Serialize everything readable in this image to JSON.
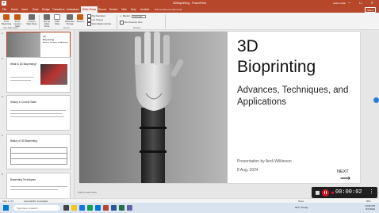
{
  "window": {
    "app_icon": "P",
    "title": "3DBioprinting - PowerPoint",
    "user": "Andrei Nalic",
    "controls": "─ ☐ ✕"
  },
  "tabs": [
    "File",
    "Home",
    "Insert",
    "Draw",
    "Design",
    "Transitions",
    "Animations",
    "Slide Show",
    "Record",
    "Review",
    "View",
    "Help",
    "Acrobat",
    "Tell me what you want to do"
  ],
  "active_tab_index": 7,
  "share_label": "Share",
  "ribbon": {
    "buttons": [
      {
        "label": "From Beginning",
        "icon": "play-icon"
      },
      {
        "label": "From Current Slide",
        "icon": "play-current-icon"
      },
      {
        "label": "Custom Slide Show",
        "icon": "custom-show-icon"
      },
      {
        "label": "Set Up Slide Show",
        "icon": "setup-icon"
      },
      {
        "label": "Hide Slide",
        "icon": "hide-slide-icon"
      },
      {
        "label": "Rehearse Timings",
        "icon": "rehearse-icon"
      },
      {
        "label": "Record",
        "icon": "record-icon"
      }
    ],
    "checkboxes": [
      "Play Narrations",
      "Use Timings",
      "Show Media Controls"
    ],
    "monitor_label": "Monitor:",
    "monitor_value": "Automatic",
    "presenter_view": "Use Presenter View",
    "groups": [
      "Start Slide Show",
      "Set Up",
      "Monitors"
    ]
  },
  "thumbnails": [
    {
      "num": "1",
      "title": "3D Bioprinting\nAdvances, Techniques, and Applications",
      "selected": true
    },
    {
      "num": "2",
      "title": "What Is 3D Bioprinting?",
      "selected": false
    },
    {
      "num": "3",
      "title": "History & Current State",
      "selected": false
    },
    {
      "num": "4",
      "title": "Basics of 3D Bioprinting",
      "selected": false
    },
    {
      "num": "5",
      "title": "Bioprinting Techniques",
      "selected": false
    }
  ],
  "slide": {
    "title_line1": "3D",
    "title_line2": "Bioprinting",
    "subtitle": "Advances, Techniques, and Applications",
    "presenter": "Presentation by Andi Wilkinson",
    "date": "8 Aug, 2024",
    "next_label": "NEXT",
    "next_arrow": "⟶"
  },
  "notes_placeholder": "Click to add notes",
  "recording": {
    "time": "00:00:02",
    "more": "⋮"
  },
  "statusbar": {
    "slide_info": "Slide 1 of 6",
    "accessibility": "Accessibility: Investigate",
    "notes": "Notes",
    "zoom": "86%"
  },
  "taskbar": {
    "search_placeholder": "Type here to search",
    "weather": "84°F Cloudy",
    "time": "10:06 PM",
    "date": "8/7/2024",
    "start_icon": "windows-icon"
  },
  "colors": {
    "accent": "#b7472a",
    "record": "#e81123"
  }
}
